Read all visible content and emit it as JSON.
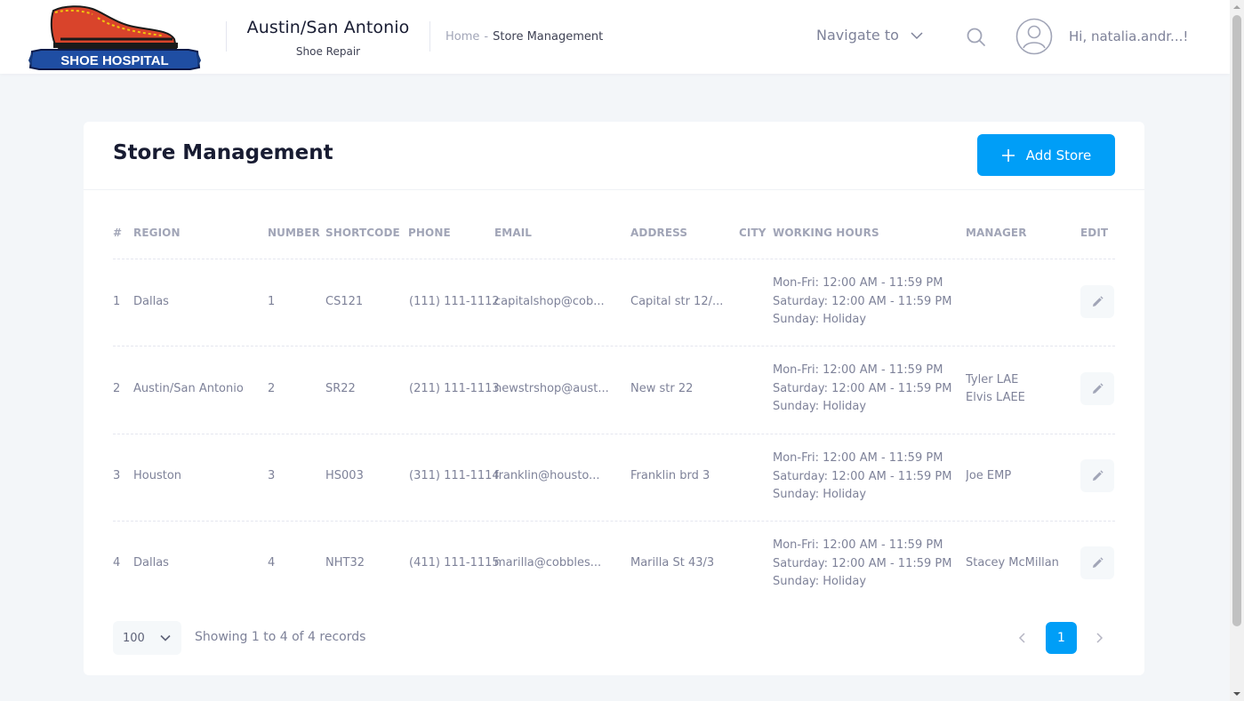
{
  "header": {
    "logo_text": "SHOE HOSPITAL",
    "store_title": "Austin/San Antonio",
    "store_subtitle": "Shoe Repair",
    "breadcrumb": {
      "home": "Home",
      "separator": "-",
      "current": "Store Management"
    },
    "navigate_label": "Navigate to",
    "greeting": "Hi, natalia.andr...!"
  },
  "page": {
    "title": "Store Management",
    "add_button": "Add Store"
  },
  "table": {
    "columns": [
      "#",
      "REGION",
      "NUMBER",
      "SHORTCODE",
      "PHONE",
      "EMAIL",
      "ADDRESS",
      "CITY",
      "WORKING HOURS",
      "MANAGER",
      "EDIT"
    ],
    "rows": [
      {
        "index": "1",
        "region": "Dallas",
        "number": "1",
        "shortcode": "CS121",
        "phone": "(111) 111-1112",
        "email": "capitalshop@cob...",
        "address": "Capital str 12/...",
        "city": "",
        "hours": [
          "Mon-Fri: 12:00 AM - 11:59 PM",
          "Saturday: 12:00 AM - 11:59 PM",
          "Sunday: Holiday"
        ],
        "managers": []
      },
      {
        "index": "2",
        "region": "Austin/San Antonio",
        "number": "2",
        "shortcode": "SR22",
        "phone": "(211) 111-1113",
        "email": "newstrshop@aust...",
        "address": "New str 22",
        "city": "",
        "hours": [
          "Mon-Fri: 12:00 AM - 11:59 PM",
          "Saturday: 12:00 AM - 11:59 PM",
          "Sunday: Holiday"
        ],
        "managers": [
          "Tyler LAE",
          "Elvis LAEE"
        ]
      },
      {
        "index": "3",
        "region": "Houston",
        "number": "3",
        "shortcode": "HS003",
        "phone": "(311) 111-1114",
        "email": "franklin@housto...",
        "address": "Franklin brd 3",
        "city": "",
        "hours": [
          "Mon-Fri: 12:00 AM - 11:59 PM",
          "Saturday: 12:00 AM - 11:59 PM",
          "Sunday: Holiday"
        ],
        "managers": [
          "Joe EMP"
        ]
      },
      {
        "index": "4",
        "region": "Dallas",
        "number": "4",
        "shortcode": "NHT32",
        "phone": "(411) 111-1115",
        "email": "marilla@cobbles...",
        "address": "Marilla St 43/3",
        "city": "",
        "hours": [
          "Mon-Fri: 12:00 AM - 11:59 PM",
          "Saturday: 12:00 AM - 11:59 PM",
          "Sunday: Holiday"
        ],
        "managers": [
          "Stacey McMillan"
        ]
      }
    ]
  },
  "footer": {
    "page_size": "100",
    "records_text": "Showing 1 to 4 of 4 records",
    "current_page": "1"
  },
  "colors": {
    "primary": "#009ef7",
    "muted_text": "#7e8299",
    "header_text": "#a1a5b7",
    "dark_text": "#181c32",
    "background": "#f3f6f9"
  },
  "icons": {
    "search": "search-icon",
    "avatar": "user-avatar-icon",
    "dropdown": "chevron-down-icon",
    "add": "plus-icon",
    "edit": "pencil-icon",
    "prev": "chevron-left-icon",
    "next": "chevron-right-icon"
  }
}
